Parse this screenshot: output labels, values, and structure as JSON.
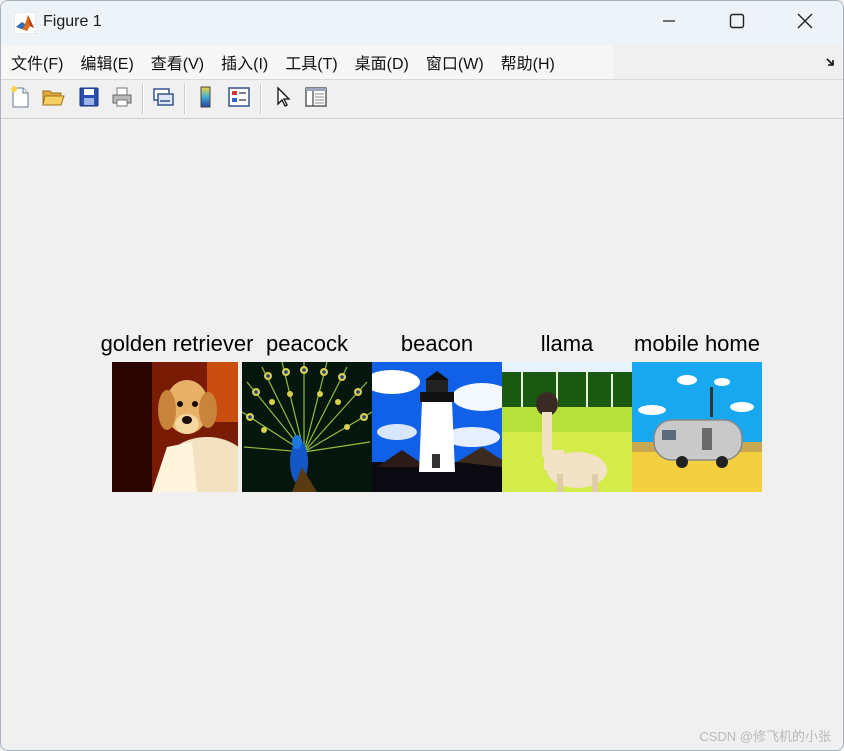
{
  "window": {
    "title": "Figure 1"
  },
  "menu": {
    "items": [
      "文件(F)",
      "编辑(E)",
      "查看(V)",
      "插入(I)",
      "工具(T)",
      "桌面(D)",
      "窗口(W)",
      "帮助(H)"
    ]
  },
  "toolbar": {
    "buttons": [
      "new-figure",
      "open-file",
      "save",
      "print",
      "link-plot",
      "insert-colorbar",
      "insert-legend",
      "edit-plot",
      "property-inspector"
    ]
  },
  "figure": {
    "images": [
      {
        "title": "golden retriever",
        "icon": "golden-retriever-image"
      },
      {
        "title": "peacock",
        "icon": "peacock-image"
      },
      {
        "title": "beacon",
        "icon": "beacon-image"
      },
      {
        "title": "llama",
        "icon": "llama-image"
      },
      {
        "title": "mobile home",
        "icon": "mobile-home-image"
      }
    ]
  },
  "watermark": "CSDN @修飞机的小张",
  "colors": {
    "titlebar": "#eef3f8",
    "menubar": "#f7f7f7",
    "background": "#f0f0f0"
  }
}
